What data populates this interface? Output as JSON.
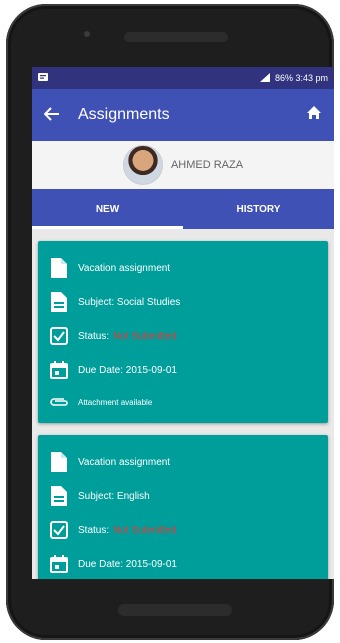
{
  "statusbar": {
    "left_icon": "notification-icon",
    "right_text": "86%  3:43 pm"
  },
  "toolbar": {
    "title": "Assignments",
    "back_icon": "arrow-back-icon",
    "home_icon": "home-icon"
  },
  "profile": {
    "name": "AHMED RAZA"
  },
  "tabs": [
    {
      "label": "NEW",
      "active": true
    },
    {
      "label": "HISTORY",
      "active": false
    }
  ],
  "assignments": [
    {
      "title": "Vacation assignment",
      "subject": "Subject: Social Studies",
      "status_label": "Status:",
      "status_value": "Not Submitted",
      "due_date": "Due Date: 2015-09-01",
      "attachment": "Attachment available"
    },
    {
      "title": "Vacation assignment",
      "subject": "Subject: English",
      "status_label": "Status:",
      "status_value": "Not Submitted",
      "due_date": "Due Date: 2015-09-01"
    }
  ],
  "colors": {
    "toolbar": "#3f51b5",
    "statusbar": "#31337f",
    "card": "#009e9b",
    "status_value": "#e53935"
  }
}
